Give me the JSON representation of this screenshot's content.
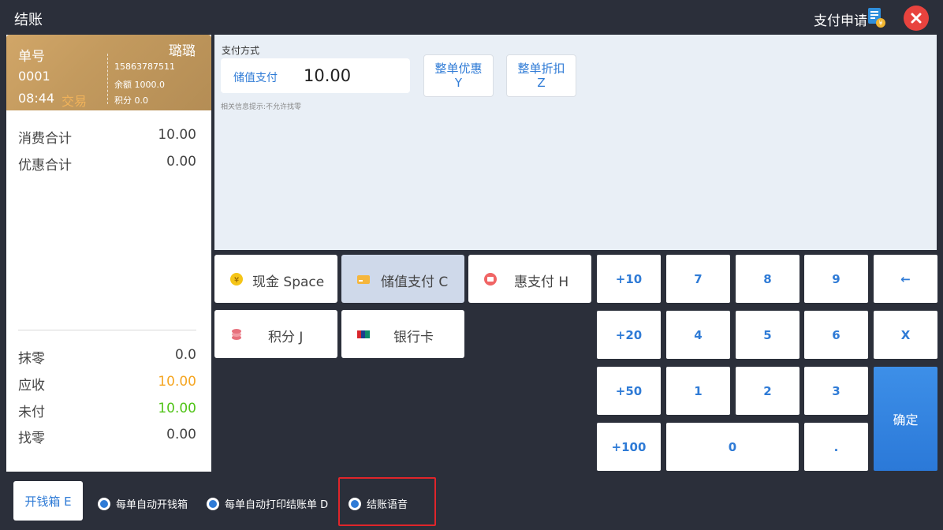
{
  "header": {
    "title": "结账",
    "pay_apply": "支付申请"
  },
  "member_card": {
    "order_label": "单号",
    "order_no": "0001",
    "time": "08:44",
    "trade_label": "交易",
    "name": "璐璐",
    "phone": "15863787511",
    "balance": "余额 1000.0",
    "points": "积分 0.0"
  },
  "summary": {
    "consume_label": "消费合计",
    "consume_value": "10.00",
    "discount_label": "优惠合计",
    "discount_value": "0.00",
    "round_label": "抹零",
    "round_value": "0.0",
    "receivable_label": "应收",
    "receivable_value": "10.00",
    "unpaid_label": "未付",
    "unpaid_value": "10.00",
    "change_label": "找零",
    "change_value": "0.00"
  },
  "payment": {
    "section_title": "支付方式",
    "method": "储值支付",
    "amount": "10.00",
    "hint": "相关信息提示:不允许找零",
    "whole_discount": "整单优惠",
    "whole_discount_key": "Y",
    "whole_rebate": "整单折扣",
    "whole_rebate_key": "Z"
  },
  "methods": {
    "cash": "现金 Space",
    "stored": "储值支付 C",
    "hui": "惠支付 H",
    "points": "积分 J",
    "bank": "银行卡"
  },
  "keypad": {
    "plus10": "+10",
    "plus20": "+20",
    "plus50": "+50",
    "plus100": "+100",
    "k7": "7",
    "k8": "8",
    "k9": "9",
    "k4": "4",
    "k5": "5",
    "k6": "6",
    "k1": "1",
    "k2": "2",
    "k3": "3",
    "k0": "0",
    "dot": ".",
    "back": "←",
    "clear": "X",
    "ok": "确定"
  },
  "bottom": {
    "drawer_button": "开钱箱 E",
    "opt_auto_drawer": "每单自动开钱箱",
    "opt_auto_print": "每单自动打印结账单 D",
    "opt_voice": "结账语音"
  },
  "colors": {
    "accent": "#2f7bd6",
    "receivable": "#f5a623",
    "unpaid": "#52c41a",
    "close": "#e8433e",
    "highlight": "#e0252a"
  }
}
